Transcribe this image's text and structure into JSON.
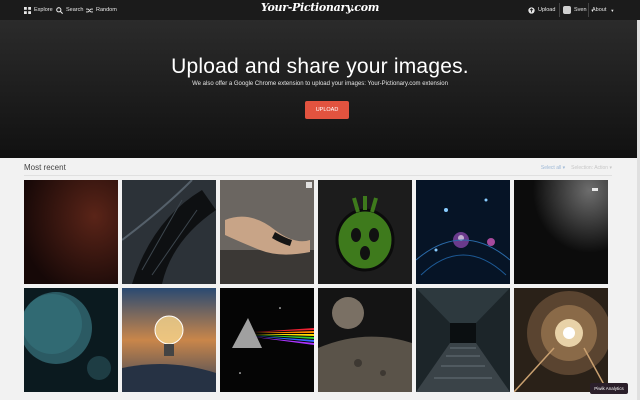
{
  "nav": {
    "explore": "Explore",
    "search": "Search",
    "random": "Random",
    "logo": "Your-Pictionary.com",
    "upload": "Upload",
    "user": "Sven",
    "about": "About"
  },
  "hero": {
    "title": "Upload and share your images.",
    "subtitle": "We also offer a Google Chrome extension to upload your images: Your-Pictionary.com extension",
    "button": "UPLOAD"
  },
  "listing": {
    "title": "Most recent",
    "select_all": "Select all",
    "selection_action": "Selection: Action"
  },
  "badge": "Piwik Analytics",
  "icons": [
    "explore-icon",
    "search-icon",
    "random-icon",
    "upload-icon",
    "avatar"
  ],
  "colors": {
    "accent": "#e2533f",
    "topbar": "#1b1b1b"
  }
}
